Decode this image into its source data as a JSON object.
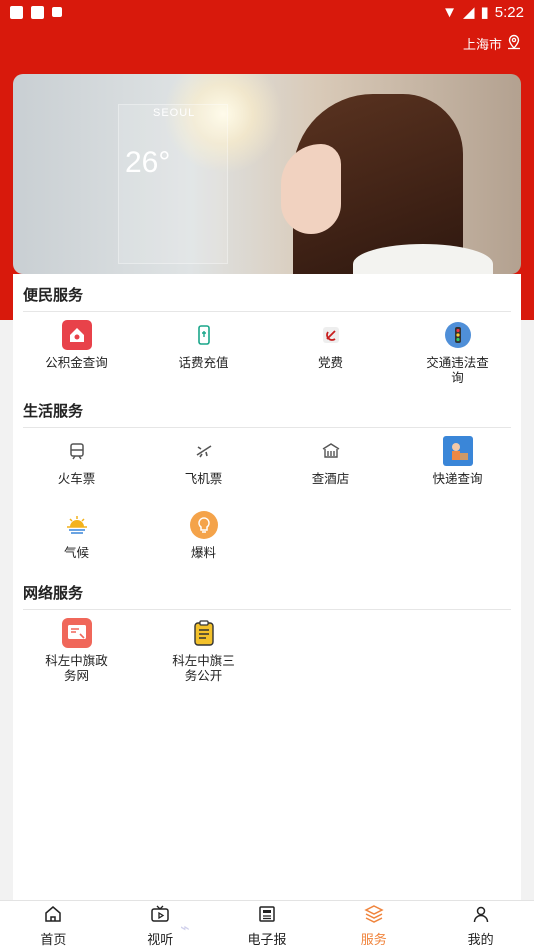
{
  "status_bar": {
    "time": "5:22"
  },
  "header": {
    "location": "上海市"
  },
  "banner": {
    "city": "SEOUL",
    "temp": "26°"
  },
  "sections": [
    {
      "title": "便民服务",
      "items": [
        {
          "label": "公积金查询",
          "icon": "house-fund-icon",
          "color": "#e8424a"
        },
        {
          "label": "话费充值",
          "icon": "phone-recharge-icon",
          "color": "#1aa68a"
        },
        {
          "label": "党费",
          "icon": "party-emblem-icon",
          "color": "#c81e1e"
        },
        {
          "label": "交通违法查询",
          "icon": "traffic-light-icon",
          "color": "#4f8fd8"
        }
      ]
    },
    {
      "title": "生活服务",
      "items": [
        {
          "label": "火车票",
          "icon": "train-icon",
          "color": "#555555"
        },
        {
          "label": "飞机票",
          "icon": "plane-icon",
          "color": "#555555"
        },
        {
          "label": "查酒店",
          "icon": "hotel-icon",
          "color": "#555555"
        },
        {
          "label": "快递查询",
          "icon": "courier-icon",
          "color": "#3a86d8"
        },
        {
          "label": "气候",
          "icon": "sunrise-icon",
          "color": "#f3b21b"
        },
        {
          "label": "爆料",
          "icon": "bulb-icon",
          "color": "#f4a34a"
        }
      ]
    },
    {
      "title": "网络服务",
      "items": [
        {
          "label": "科左中旗政务网",
          "icon": "gov-web-icon",
          "color": "#f0675a"
        },
        {
          "label": "科左中旗三务公开",
          "icon": "clipboard-icon",
          "color": "#f3c12b"
        }
      ]
    }
  ],
  "tabs": [
    {
      "label": "首页",
      "icon": "home-icon"
    },
    {
      "label": "视听",
      "icon": "tv-icon"
    },
    {
      "label": "电子报",
      "icon": "newspaper-icon"
    },
    {
      "label": "服务",
      "icon": "layers-icon"
    },
    {
      "label": "我的",
      "icon": "user-icon"
    }
  ],
  "active_tab": "服务",
  "accent_color": "#d8190c"
}
